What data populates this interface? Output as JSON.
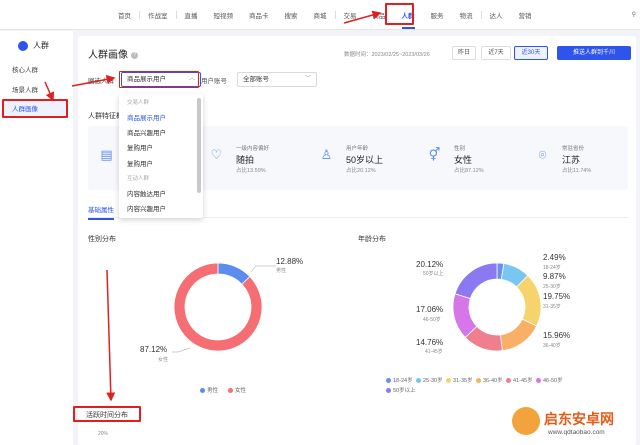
{
  "topnav": {
    "items": [
      "首页",
      "作战室",
      "直播",
      "短视频",
      "商品卡",
      "搜索",
      "商城",
      "交易",
      "商品",
      "人群",
      "服务",
      "物流",
      "达人",
      "营销"
    ],
    "active_index": 9,
    "account_icon": "user-icon"
  },
  "sidebar": {
    "title": "人群",
    "items": [
      "核心人群",
      "场景人群",
      "人群画像"
    ],
    "active_index": 2
  },
  "page": {
    "title": "人群画像",
    "date_range": "数据时间：2023/02/25~2023/03/26",
    "range_buttons": [
      "昨日",
      "近7天",
      "近30天"
    ],
    "active_range_index": 2,
    "push_button": "推送人群到千川",
    "filter_label": "圈选人群",
    "filter_value": "商品展示用户",
    "account_label": "用户账号",
    "account_value": "全部账号"
  },
  "dropdown": {
    "section1": "交易人群",
    "options1": [
      "商品展示用户",
      "商品兴趣用户",
      "复购用户",
      "复购用户"
    ],
    "section2": "互动人群",
    "options2": [
      "内容触达用户",
      "内容兴趣用户"
    ]
  },
  "overview": {
    "title": "人群特征概况",
    "stats": [
      {
        "key": "",
        "value": "",
        "sub": "",
        "icon": "chart-icon"
      },
      {
        "key": "一级内容偏好",
        "value": "随拍",
        "sub": "占比13.59%",
        "icon": "heart-icon"
      },
      {
        "key": "用户年龄",
        "value": "50岁以上",
        "sub": "占比20.12%",
        "icon": "person-icon"
      },
      {
        "key": "性别",
        "value": "女性",
        "sub": "占比87.12%",
        "icon": "gender-icon"
      },
      {
        "key": "常驻省份",
        "value": "江苏",
        "sub": "占比11.74%",
        "icon": "location-icon"
      }
    ]
  },
  "tabs": [
    "基础属性"
  ],
  "gender": {
    "title": "性别分布",
    "male_pct": "12.88%",
    "male_label": "男性",
    "female_pct": "87.12%",
    "female_label": "女性",
    "legend": [
      "男性",
      "女性"
    ]
  },
  "age": {
    "title": "年龄分布",
    "labels": [
      {
        "pct": "20.12%",
        "range": "50岁以上"
      },
      {
        "pct": "17.06%",
        "range": "46-50岁"
      },
      {
        "pct": "14.76%",
        "range": "41-45岁"
      },
      {
        "pct": "2.49%",
        "range": "18-24岁"
      },
      {
        "pct": "9.87%",
        "range": "25-30岁"
      },
      {
        "pct": "19.75%",
        "range": "31-35岁"
      },
      {
        "pct": "15.96%",
        "range": "36-40岁"
      }
    ],
    "legend": [
      "18-24岁",
      "25-30岁",
      "31-35岁",
      "36-40岁",
      "41-45岁",
      "46-50岁",
      "50岁以上"
    ]
  },
  "active_time": {
    "title": "活跃时间分布",
    "first_tick": "20%"
  },
  "watermark": {
    "name": "启东安卓网",
    "url": "www.qdtaobao.com"
  },
  "colors": {
    "accent": "#2f54eb",
    "male": "#5b8def",
    "female": "#f56e73",
    "annotation": "#e02020"
  },
  "chart_data": [
    {
      "type": "pie",
      "title": "性别分布",
      "categories": [
        "男性",
        "女性"
      ],
      "values": [
        12.88,
        87.12
      ]
    },
    {
      "type": "pie",
      "title": "年龄分布",
      "categories": [
        "18-24岁",
        "25-30岁",
        "31-35岁",
        "36-40岁",
        "41-45岁",
        "46-50岁",
        "50岁以上"
      ],
      "values": [
        2.49,
        9.87,
        19.75,
        15.96,
        14.76,
        17.06,
        20.12
      ],
      "colors": [
        "#6a8ff0",
        "#79c6f2",
        "#f7d36b",
        "#f8b067",
        "#f07f8e",
        "#d676e8",
        "#8a79f0"
      ]
    }
  ]
}
